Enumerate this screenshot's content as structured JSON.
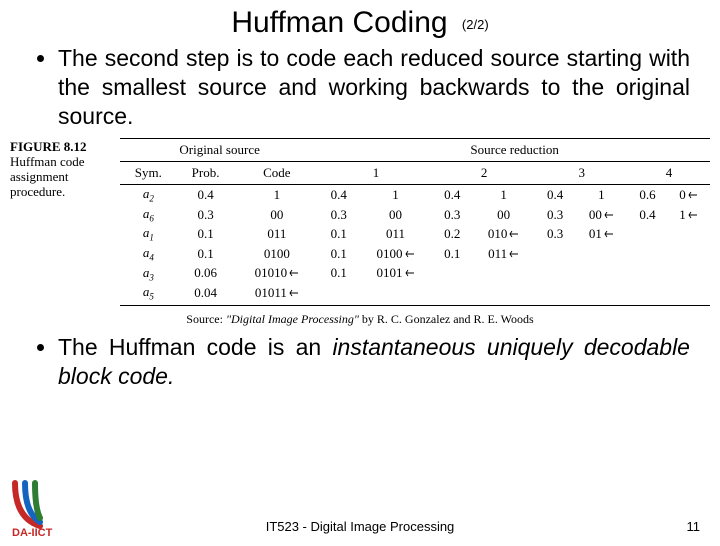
{
  "title": "Huffman Coding",
  "title_suffix": "(2/2)",
  "bullets": {
    "b1": "The second step is to code each reduced source starting with the smallest source and working backwards to the original source.",
    "b2_pre": "The Huffman code is an ",
    "b2_em": "instantaneous uniquely decodable block code.",
    "b2_post": ""
  },
  "figure": {
    "label": "FIGURE 8.12",
    "caption": "Huffman code assignment procedure."
  },
  "table": {
    "group_original": "Original source",
    "group_reduction": "Source reduction",
    "headers": {
      "sym": "Sym.",
      "prob": "Prob.",
      "code": "Code",
      "r1": "1",
      "r2": "2",
      "r3": "3",
      "r4": "4"
    },
    "rows": [
      {
        "sym": "a2",
        "sub": "2",
        "prob": "0.4",
        "code": "1",
        "r1p": "0.4",
        "r1c": "1",
        "r2p": "0.4",
        "r2c": "1",
        "r3p": "0.4",
        "r3c": "1",
        "r4p": "0.6",
        "r4c": "0"
      },
      {
        "sym": "a6",
        "sub": "6",
        "prob": "0.3",
        "code": "00",
        "r1p": "0.3",
        "r1c": "00",
        "r2p": "0.3",
        "r2c": "00",
        "r3p": "0.3",
        "r3c": "00",
        "r4p": "0.4",
        "r4c": "1"
      },
      {
        "sym": "a1",
        "sub": "1",
        "prob": "0.1",
        "code": "011",
        "r1p": "0.1",
        "r1c": "011",
        "r2p": "0.2",
        "r2c": "010",
        "r3p": "0.3",
        "r3c": "01",
        "r4p": "",
        "r4c": ""
      },
      {
        "sym": "a4",
        "sub": "4",
        "prob": "0.1",
        "code": "0100",
        "r1p": "0.1",
        "r1c": "0100",
        "r2p": "0.1",
        "r2c": "011",
        "r3p": "",
        "r3c": "",
        "r4p": "",
        "r4c": ""
      },
      {
        "sym": "a3",
        "sub": "3",
        "prob": "0.06",
        "code": "01010",
        "r1p": "0.1",
        "r1c": "0101",
        "r2p": "",
        "r2c": "",
        "r3p": "",
        "r3c": "",
        "r4p": "",
        "r4c": ""
      },
      {
        "sym": "a5",
        "sub": "5",
        "prob": "0.04",
        "code": "01011",
        "r1p": "",
        "r1c": "",
        "r2p": "",
        "r2c": "",
        "r3p": "",
        "r3c": "",
        "r4p": "",
        "r4c": ""
      }
    ]
  },
  "source_credit": {
    "prefix": "Source: ",
    "title": "\"Digital Image Processing\"",
    "suffix": " by R. C. Gonzalez and R. E. Woods"
  },
  "footer": "IT523 - Digital Image Processing",
  "page_number": "11",
  "logo_text": "DA-IICT"
}
